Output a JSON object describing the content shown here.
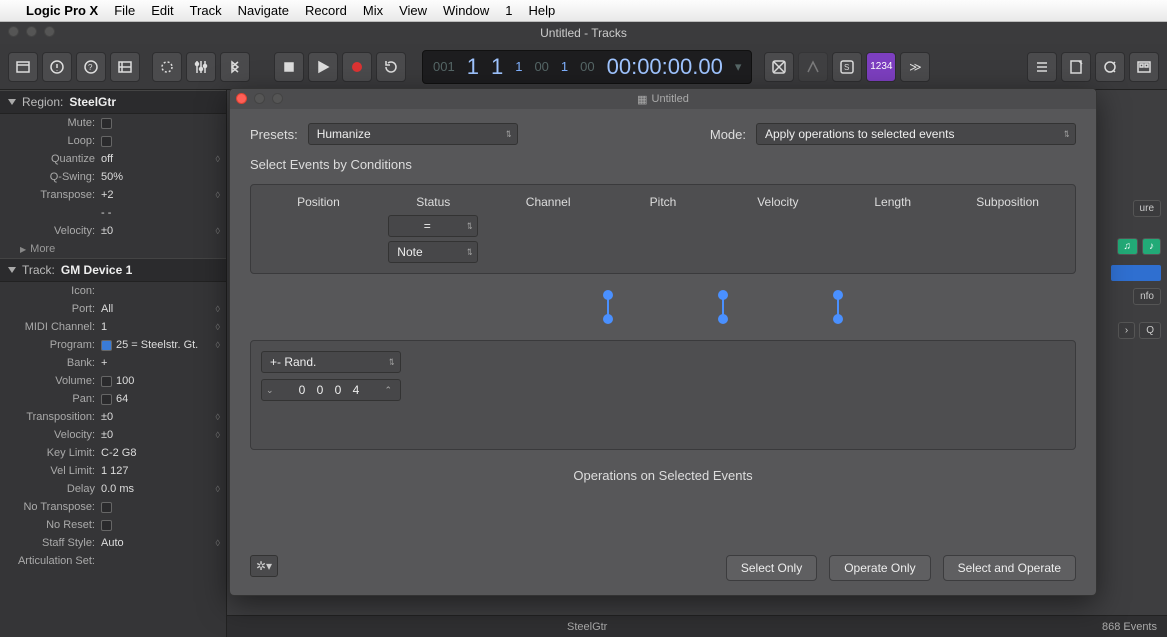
{
  "menubar": [
    "Logic Pro X",
    "File",
    "Edit",
    "Track",
    "Navigate",
    "Record",
    "Mix",
    "View",
    "Window",
    "1",
    "Help"
  ],
  "window_title": "Untitled - Tracks",
  "lcd": {
    "bars": "1",
    "beats": "1",
    "div": "1",
    "ticks": "1",
    "smpte": "00:00:00.00",
    "pre_bars": "001",
    "pre_ticks": "00",
    "pre_smpte": "00",
    "tempo_badge": "1234"
  },
  "inspector": {
    "region": {
      "header_label": "Region:",
      "name": "SteelGtr",
      "rows": [
        {
          "lbl": "Mute:",
          "val": "",
          "chk": true
        },
        {
          "lbl": "Loop:",
          "val": "",
          "chk": true
        },
        {
          "lbl": "Quantize",
          "val": "off",
          "stepper": true
        },
        {
          "lbl": "Q-Swing:",
          "val": "50%"
        },
        {
          "lbl": "Transpose:",
          "val": "+2",
          "stepper": true
        },
        {
          "lbl": "",
          "val": "-  -"
        },
        {
          "lbl": "Velocity:",
          "val": "±0",
          "stepper": true
        }
      ],
      "more": "More"
    },
    "track": {
      "header_label": "Track:",
      "name": "GM Device 1",
      "rows": [
        {
          "lbl": "Icon:",
          "val": ""
        },
        {
          "lbl": "Port:",
          "val": "All",
          "stepper": true
        },
        {
          "lbl": "MIDI Channel:",
          "val": "1",
          "stepper": true
        },
        {
          "lbl": "Program:",
          "val": "25 = Steelstr. Gt.",
          "chk": true,
          "checked": true,
          "stepper": true
        },
        {
          "lbl": "Bank:",
          "val": "+"
        },
        {
          "lbl": "Volume:",
          "val": "100",
          "chk": true
        },
        {
          "lbl": "Pan:",
          "val": "64",
          "chk": true
        },
        {
          "lbl": "Transposition:",
          "val": "±0",
          "stepper": true
        },
        {
          "lbl": "Velocity:",
          "val": "±0",
          "stepper": true
        },
        {
          "lbl": "Key Limit:",
          "val": "C-2  G8"
        },
        {
          "lbl": "Vel Limit:",
          "val": "1  127"
        },
        {
          "lbl": "Delay",
          "val": "0.0 ms",
          "stepper": true
        },
        {
          "lbl": "No Transpose:",
          "val": "",
          "chk": true
        },
        {
          "lbl": "No Reset:",
          "val": "",
          "chk": true
        },
        {
          "lbl": "Staff Style:",
          "val": "Auto",
          "stepper": true
        },
        {
          "lbl": "Articulation Set:",
          "val": ""
        }
      ]
    }
  },
  "modal": {
    "title": "Untitled",
    "presets_label": "Presets:",
    "preset": "Humanize",
    "mode_label": "Mode:",
    "mode": "Apply operations to selected events",
    "select_heading": "Select Events by Conditions",
    "columns": [
      "Position",
      "Status",
      "Channel",
      "Pitch",
      "Velocity",
      "Length",
      "Subposition"
    ],
    "status_op": "=",
    "status_val": "Note",
    "op_dropdown": "+- Rand.",
    "op_value": "0 0 0   4",
    "ops_heading": "Operations on Selected Events",
    "buttons": {
      "select": "Select Only",
      "operate": "Operate Only",
      "both": "Select and Operate"
    }
  },
  "footer": {
    "track": "SteelGtr",
    "events": "868 Events"
  },
  "right_extras": {
    "info": "nfo",
    "q": "Q",
    "ure": "ure"
  }
}
